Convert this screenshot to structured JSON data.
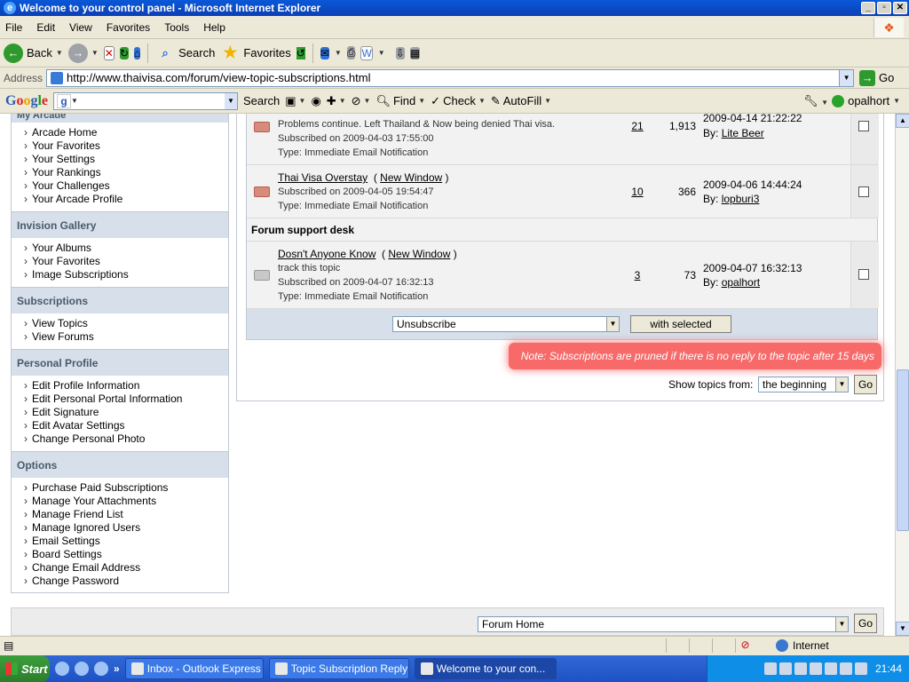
{
  "window": {
    "title": "Welcome to your control panel - Microsoft Internet Explorer"
  },
  "menu": [
    "File",
    "Edit",
    "View",
    "Favorites",
    "Tools",
    "Help"
  ],
  "toolbar": {
    "back": "Back",
    "search": "Search",
    "favorites": "Favorites"
  },
  "address": {
    "label": "Address",
    "url": "http://www.thaivisa.com/forum/view-topic-subscriptions.html",
    "go": "Go"
  },
  "google_bar": {
    "logo": "Google",
    "search": "Search",
    "find": "Find",
    "check": "Check",
    "autofill": "AutoFill",
    "user": "opalhort"
  },
  "sidebar": {
    "cut_heading": "My Arcade",
    "sections": [
      {
        "heading": "",
        "items": [
          "Arcade Home",
          "Your Favorites",
          "Your Settings",
          "Your Rankings",
          "Your Challenges",
          "Your Arcade Profile"
        ]
      },
      {
        "heading": "Invision Gallery",
        "items": [
          "Your Albums",
          "Your Favorites",
          "Image Subscriptions"
        ]
      },
      {
        "heading": "Subscriptions",
        "items": [
          "View Topics",
          "View Forums"
        ]
      },
      {
        "heading": "Personal Profile",
        "items": [
          "Edit Profile Information",
          "Edit Personal Portal Information",
          "Edit Signature",
          "Edit Avatar Settings",
          "Change Personal Photo"
        ]
      },
      {
        "heading": "Options",
        "items": [
          "Purchase Paid Subscriptions",
          "Manage Your Attachments",
          "Manage Friend List",
          "Manage Ignored Users",
          "Email Settings",
          "Board Settings",
          "Change Email Address",
          "Change Password"
        ]
      }
    ]
  },
  "topics": [
    {
      "title": "",
      "new_window": "",
      "description": "Problems continue. Left Thailand & Now being denied Thai visa.",
      "subscribed": "Subscribed on 2009-04-03 17:55:00",
      "type": "Type: Immediate Email Notification",
      "replies": "21",
      "views": "1,913",
      "last_date": "2009-04-14 21:22:22",
      "by_label": "By:",
      "by_user": "Lite Beer"
    },
    {
      "title": "Thai Visa Overstay",
      "new_window": "New Window",
      "description": "",
      "subscribed": "Subscribed on 2009-04-05 19:54:47",
      "type": "Type: Immediate Email Notification",
      "replies": "10",
      "views": "366",
      "last_date": "2009-04-06 14:44:24",
      "by_label": "By:",
      "by_user": "lopburi3"
    },
    {
      "group": "Forum support desk",
      "title": "Dosn't Anyone Know",
      "new_window": "New Window",
      "description": "track this topic",
      "subscribed": "Subscribed on 2009-04-07 16:32:13",
      "type": "Type: Immediate Email Notification",
      "replies": "3",
      "views": "73",
      "last_date": "2009-04-07 16:32:13",
      "by_label": "By:",
      "by_user": "opalhort"
    }
  ],
  "actions": {
    "select_value": "Unsubscribe",
    "with_selected": "with selected"
  },
  "note": "Note: Subscriptions are pruned if there is no reply to the topic after 15 days",
  "show_topics": {
    "label": "Show topics from:",
    "value": "the beginning",
    "go": "Go"
  },
  "jump": {
    "value": "Forum Home",
    "go": "Go"
  },
  "status": {
    "zone": "Internet"
  },
  "taskbar": {
    "start": "Start",
    "tasks": [
      "Inbox - Outlook Express",
      "Topic Subscription Reply ...",
      "Welcome to your con..."
    ],
    "clock": "21:44"
  }
}
